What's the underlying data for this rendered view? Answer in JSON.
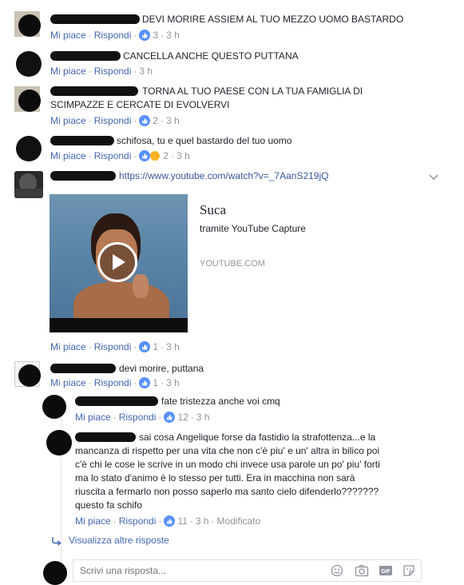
{
  "comments": [
    {
      "text": "DEVI MORIRE ASSIEM AL TUO MEZZO UOMO BASTARDO",
      "like_label": "Mi piace",
      "reply_label": "Rispondi",
      "count": "3",
      "time": "3 h"
    },
    {
      "text": "CANCELLA ANCHE QUESTO PUTTANA",
      "like_label": "Mi piace",
      "reply_label": "Rispondi",
      "time": "3 h"
    },
    {
      "text_line1": "TORNA AL TUO PAESE CON LA TUA FAMIGLIA DI",
      "text_line2": "SCIMPAZZE E CERCATE DI EVOLVERVI",
      "like_label": "Mi piace",
      "reply_label": "Rispondi",
      "count": "2",
      "time": "3 h"
    },
    {
      "text": "schifosa, tu e quel bastardo del tuo uomo",
      "like_label": "Mi piace",
      "reply_label": "Rispondi",
      "count": "2",
      "time": "3 h"
    },
    {
      "link": "https://www.youtube.com/watch?v=_7AanS219jQ",
      "preview_title": "Suca",
      "preview_subtitle": "tramite YouTube Capture",
      "preview_domain": "YOUTUBE.COM",
      "like_label": "Mi piace",
      "reply_label": "Rispondi",
      "count": "1",
      "time": "3 h"
    },
    {
      "text": "devi morire, puttana",
      "like_label": "Mi piace",
      "reply_label": "Rispondi",
      "count": "1",
      "time": "3 h"
    }
  ],
  "replies": [
    {
      "text": "fate tristezza anche voi cmq",
      "like_label": "Mi piace",
      "reply_label": "Rispondi",
      "count": "12",
      "time": "3 h"
    },
    {
      "lines": [
        "sai cosa Angelique forse da fastidio la strafottenza...e la",
        "mancanza di rispetto per una vita che non c'è piu' e un' altra in bilico poi",
        "c'è chi le cose le scrive in un modo chi invece usa parole un po' piu' forti",
        "ma lo stato d'animo è lo stesso per tutti. Era in macchina non sarà",
        "riuscita a fermarlo non posso saperlo ma santo cielo difenderlo???????",
        "questo fa schifo"
      ],
      "like_label": "Mi piace",
      "reply_label": "Rispondi",
      "count": "11",
      "time": "3 h",
      "edited": "Modificato"
    }
  ],
  "more_replies": "Visualizza altre risposte",
  "reply_box": {
    "placeholder": "Scrivi una risposta..."
  },
  "colors": {
    "link": "#4267b2",
    "meta": "#90949c",
    "text": "#1d2129",
    "like": "#5890ff"
  }
}
